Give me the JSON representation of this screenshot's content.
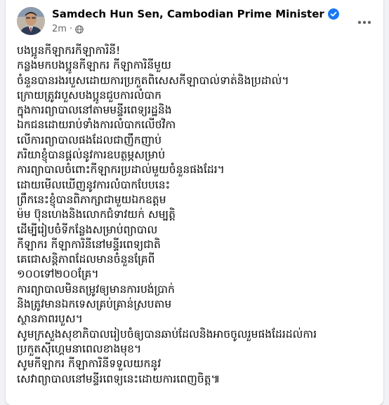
{
  "post": {
    "author": "Samdech Hun Sen, Cambodian Prime Minister",
    "time": "2m",
    "separator": "·",
    "privacy_icon": "globe-icon",
    "verified_icon": "verified-badge-icon",
    "more_icon": "more-options-icon",
    "lines": [
      "បងប្អូនកីឡាករកីឡាការិនី!",
      "កន្លងមកបងប្អូនកីឡាករ កីឡាការិនីមួយ",
      "ចំនួនបានរងរបួសដោយការប្រកួតពិសេសកីឡាបាល់ទាត់និងប្រដាល់។",
      "ក្រោយត្រូវរបួសបងប្អូនជួបការលំបាក",
      "ក្នុងការព្យាបាលនៅតាមមន្ទីរពេទ្យរដ្ឋនិង",
      "ឯកជនដោយរាប់ទាំងការលំបាកលើថវិកា",
      "លើការព្យាបាលផងដែលជាញឹកញាប់",
      "ភរិយាខ្ញុំបានផ្ដល់នូវការឧបត្ថម្ភសម្រាប់",
      "ការព្យាបាលចំពោះកីឡាករប្រដាល់មួយចំនួនផងដែរ។",
      "ដោយមើលឃើញនូវការលំបាកបែបនេះ",
      "ព្រឹកនេះខ្ញុំបានពិភាក្សាជាមួយឯកឧត្តម",
      "ម៉ម ប៊ុនហេងនិងលោកជំទាវយក់ សម្បត្តិ",
      "ដើម្បីរៀបចំទីកន្លែងសម្រាប់ព្យាបាល",
      "កីឡាករ កីឡាការិនីនៅមន្ទីរពេទ្យជាតិ",
      "គេជោសន្តិភាពដែលមានចំនួនគ្រែពី",
      "១០០ទៅ២០០គ្រែ។",
      "ការព្យាបាលមិនតម្រូវឲ្យមានការបង់ប្រាក់",
      "និងត្រូវមានឯកទេសគ្រប់គ្រាន់ស្របតាម",
      "ស្ថានភាពរបួស។",
      "សូមក្រសួងសុខាភិបាលរៀបចំឲ្យបានឆាប់ដែលនិងអាចចូលរួមផងដែរដល់ការ",
      "ប្រកួតស៊ីហ្គេមនាពេលខាងមុខ។",
      "សូមកីឡាករ កីឡាការិនីទទួលយកនូវ",
      "សេវាព្យាបាលនៅមន្ទីរពេទ្យនេះដោយការពេញចិត្ត៕"
    ]
  }
}
